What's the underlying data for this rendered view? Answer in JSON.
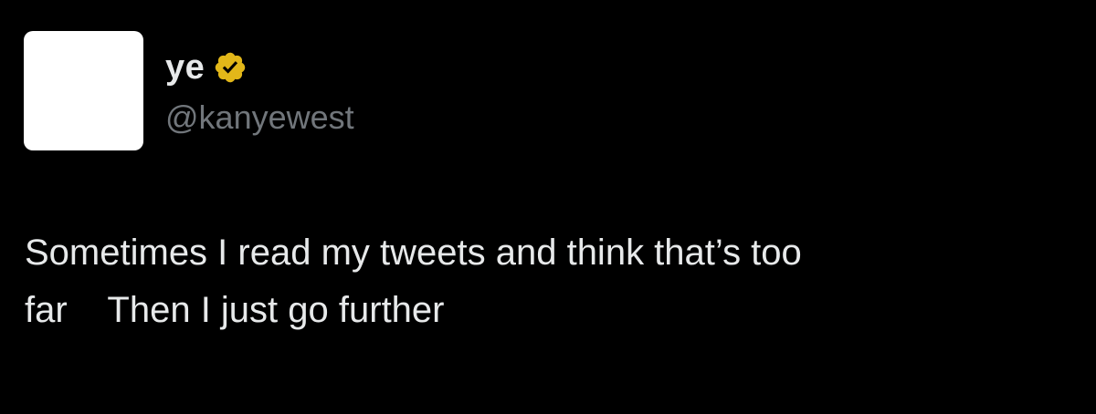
{
  "author": {
    "display_name": "ye",
    "handle": "@kanyewest",
    "verified_badge_icon": "verified-badge-icon",
    "badge_color": "#e2b719"
  },
  "tweet": {
    "text_line1": "Sometimes I read my tweets and think that’s too",
    "text_line2": "far    Then I just go further"
  },
  "colors": {
    "background": "#000000",
    "primary_text": "#e7e9ea",
    "secondary_text": "#71767b",
    "avatar": "#ffffff"
  }
}
